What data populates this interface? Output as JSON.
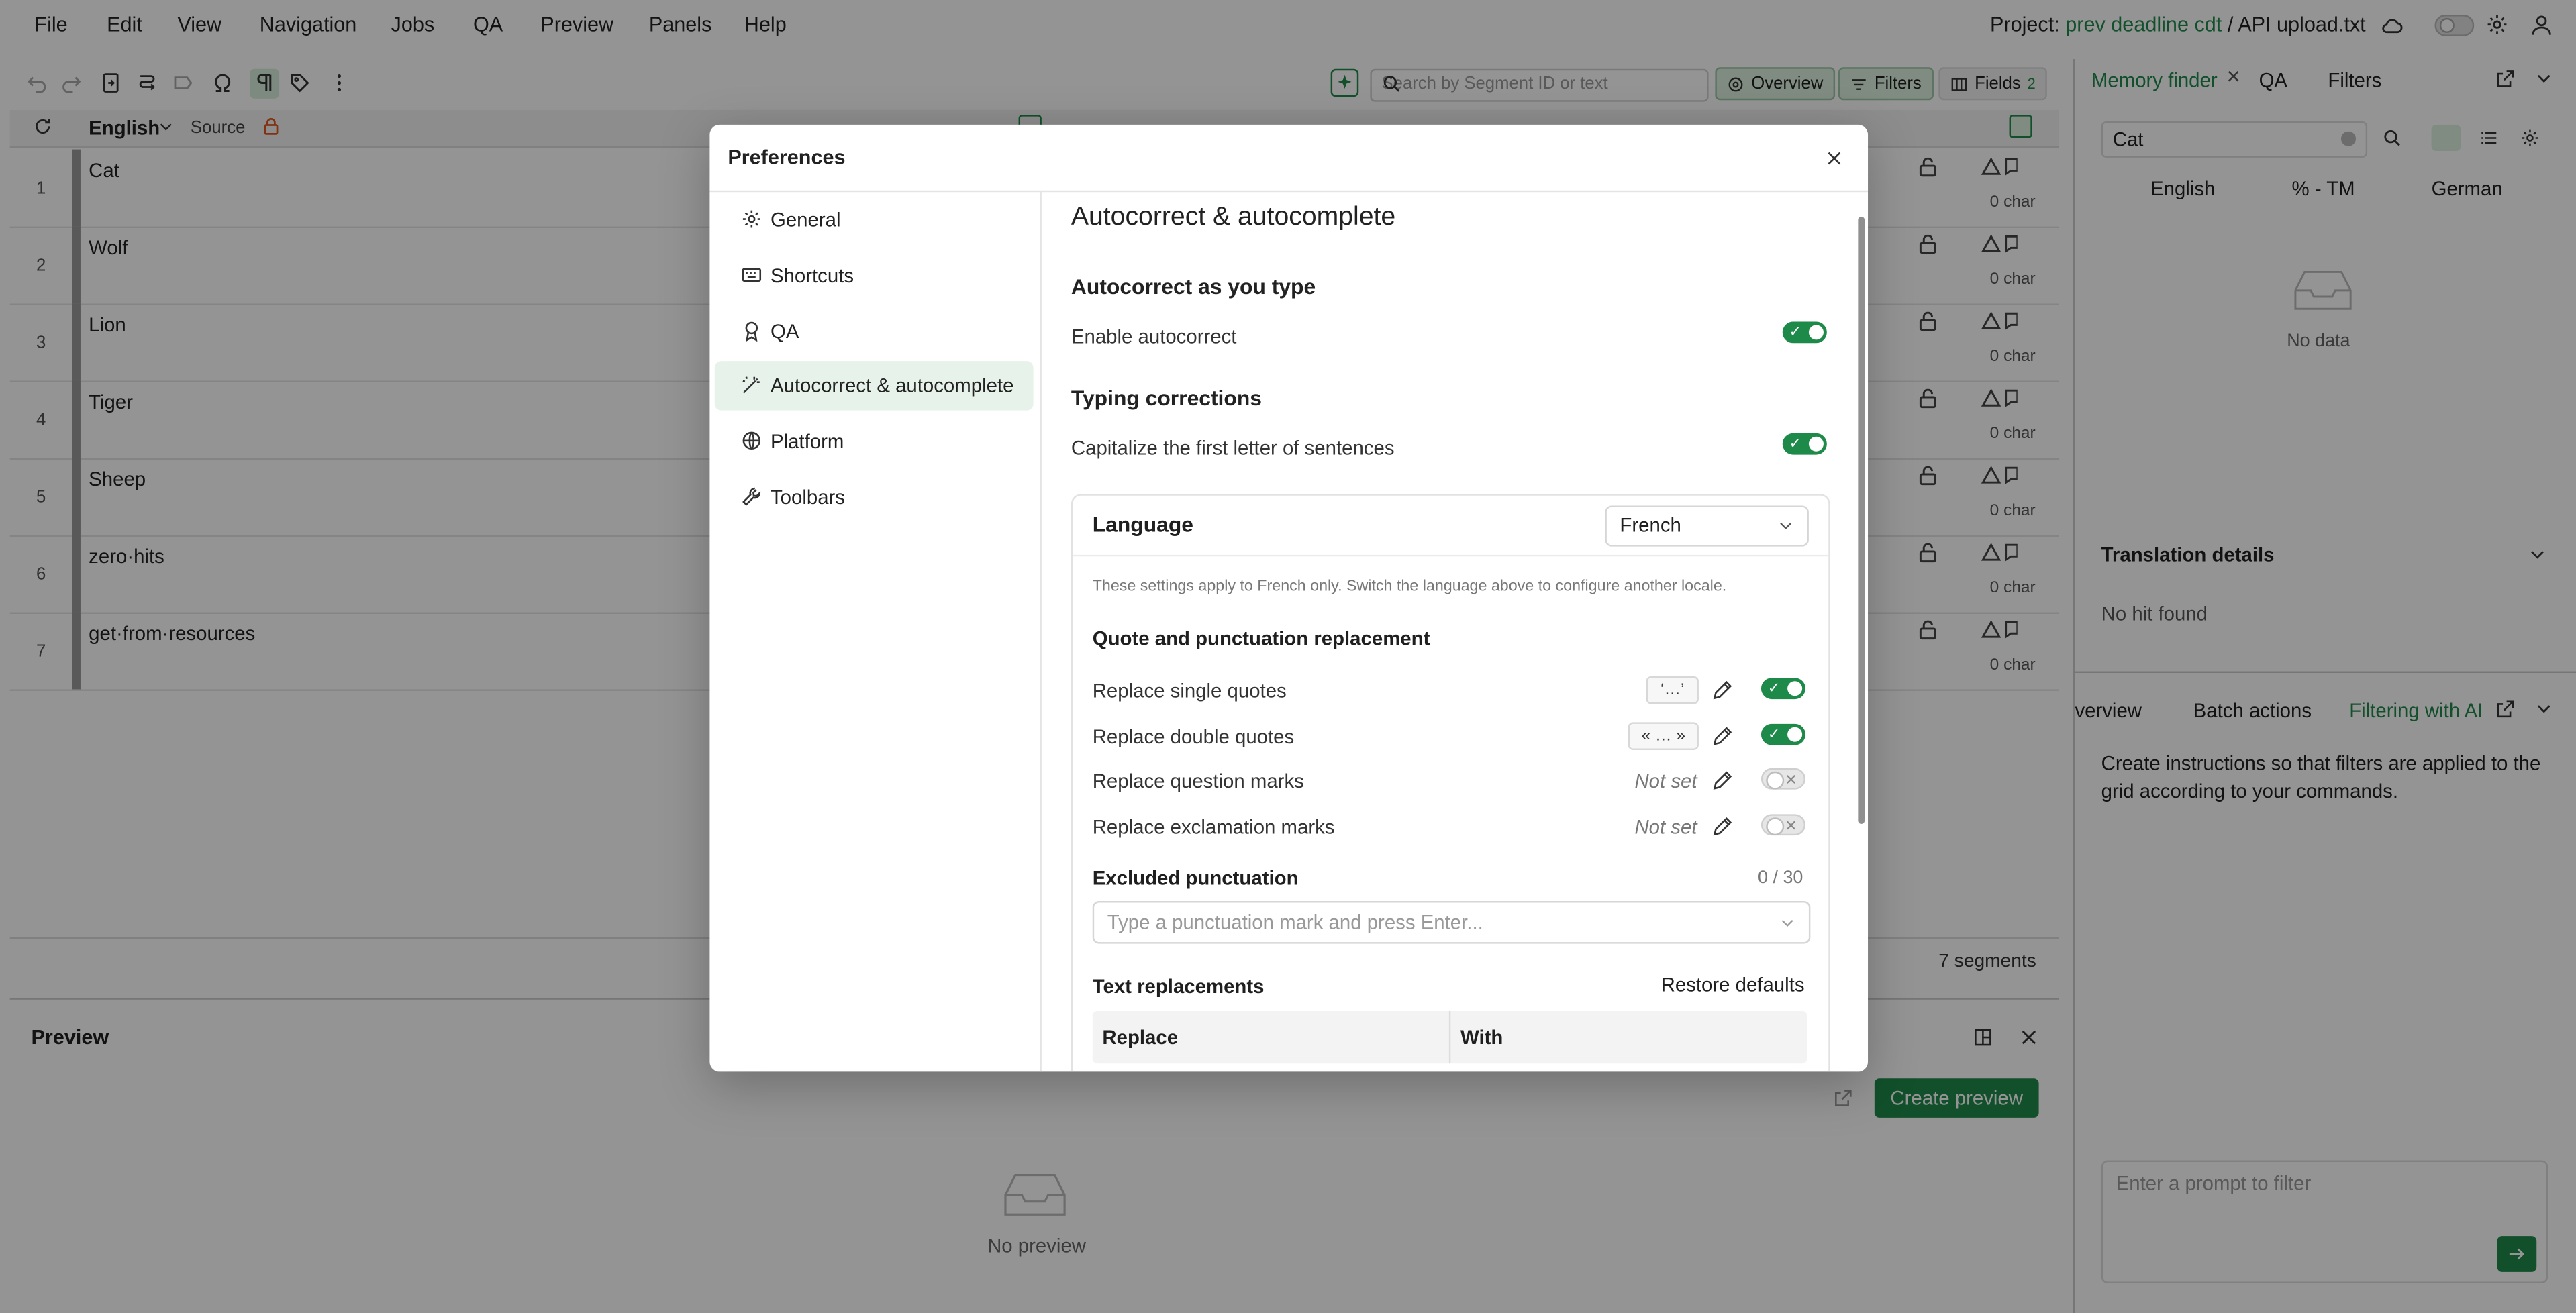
{
  "menubar": {
    "items": [
      "File",
      "Edit",
      "View",
      "Navigation",
      "Jobs",
      "QA",
      "Preview",
      "Panels",
      "Help"
    ],
    "project_label": "Project:",
    "project_name": "prev deadline cdt",
    "file_name": "API upload.txt"
  },
  "toolbar": {
    "search_placeholder": "Search by Segment ID or text",
    "overview_label": "Overview",
    "filters_label": "Filters",
    "fields_label": "Fields",
    "fields_count": "2"
  },
  "grid": {
    "language": "English",
    "source_label": "Source",
    "rows": [
      {
        "num": "1",
        "text": "Cat",
        "chars": "0 char"
      },
      {
        "num": "2",
        "text": "Wolf",
        "chars": "0 char"
      },
      {
        "num": "3",
        "text": "Lion",
        "chars": "0 char"
      },
      {
        "num": "4",
        "text": "Tiger",
        "chars": "0 char"
      },
      {
        "num": "5",
        "text": "Sheep",
        "chars": "0 char"
      },
      {
        "num": "6",
        "text": "zero·hits",
        "chars": "0 char"
      },
      {
        "num": "7",
        "text": "get·from·resources",
        "chars": "0 char"
      }
    ],
    "segment_count": "7 segments"
  },
  "preview": {
    "title": "Preview",
    "create_button": "Create preview",
    "empty_text": "No preview"
  },
  "right_panel": {
    "tabs": [
      "Memory finder",
      "QA",
      "Filters"
    ],
    "search_value": "Cat",
    "columns": [
      "English",
      "% - TM",
      "German"
    ],
    "no_data": "No data",
    "translation_details": "Translation details",
    "no_hit": "No hit found",
    "bottom_tabs": [
      "verview",
      "Batch actions",
      "Filtering with AI"
    ],
    "ai_description": "Create instructions so that filters are applied to the grid according to your commands.",
    "prompt_placeholder": "Enter a prompt to filter"
  },
  "modal": {
    "title": "Preferences",
    "nav": [
      {
        "label": "General",
        "icon": "gear-icon"
      },
      {
        "label": "Shortcuts",
        "icon": "keyboard-icon"
      },
      {
        "label": "QA",
        "icon": "award-icon"
      },
      {
        "label": "Autocorrect & autocomplete",
        "icon": "magic-wand-icon"
      },
      {
        "label": "Platform",
        "icon": "globe-icon"
      },
      {
        "label": "Toolbars",
        "icon": "wrench-icon"
      }
    ],
    "active_nav": "Autocorrect & autocomplete",
    "heading": "Autocorrect & autocomplete",
    "section1_title": "Autocorrect as you type",
    "enable_autocorrect": {
      "label": "Enable autocorrect",
      "on": true
    },
    "section2_title": "Typing corrections",
    "capitalize": {
      "label": "Capitalize the first letter of sentences",
      "on": true
    },
    "language_card": {
      "title": "Language",
      "selected": "French",
      "hint": "These settings apply to French only. Switch the language above to configure another locale.",
      "quote_section": "Quote and punctuation replacement",
      "rows": [
        {
          "label": "Replace single quotes",
          "value": "‘…’",
          "set": true,
          "on": true
        },
        {
          "label": "Replace double quotes",
          "value": "« … »",
          "set": true,
          "on": true
        },
        {
          "label": "Replace question marks",
          "value": "Not set",
          "set": false,
          "on": false
        },
        {
          "label": "Replace exclamation marks",
          "value": "Not set",
          "set": false,
          "on": false
        }
      ],
      "excluded_title": "Excluded punctuation",
      "excluded_count": "0 / 30",
      "excluded_placeholder": "Type a punctuation mark and press Enter...",
      "text_replacements": "Text replacements",
      "restore_defaults": "Restore defaults",
      "table_headers": [
        "Replace",
        "With"
      ]
    }
  },
  "colors": {
    "accent": "#1e8a4a",
    "link": "#1f8a4c",
    "warning": "#e0571f"
  }
}
